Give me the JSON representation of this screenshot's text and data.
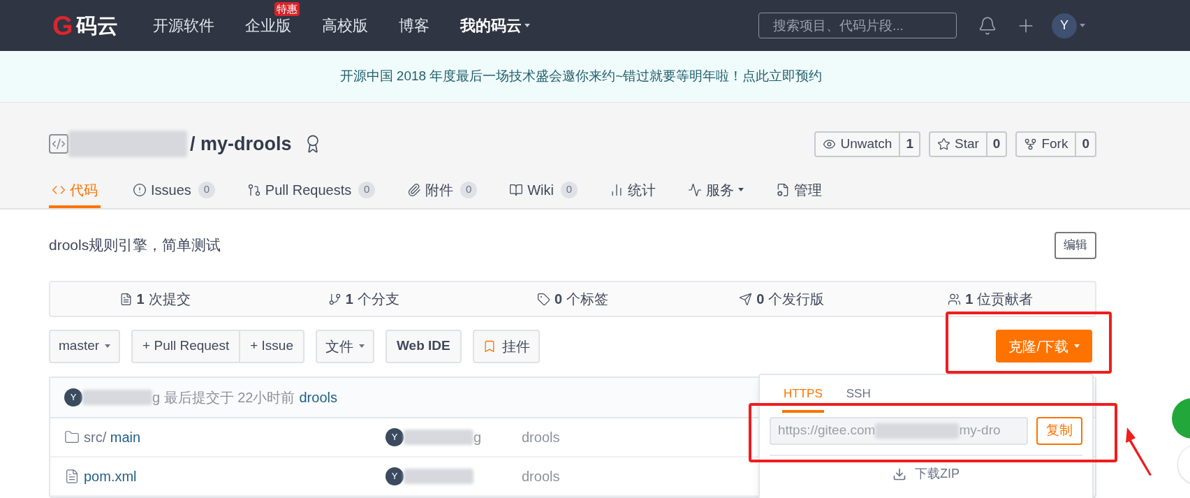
{
  "nav": {
    "logo_mark": "G",
    "logo_text": "码云",
    "items": [
      {
        "label": "开源软件",
        "selected": false,
        "dropdown": false
      },
      {
        "label": "企业版",
        "selected": false,
        "dropdown": false,
        "badge": "特惠"
      },
      {
        "label": "高校版",
        "selected": false,
        "dropdown": false
      },
      {
        "label": "博客",
        "selected": false,
        "dropdown": false
      },
      {
        "label": "我的码云",
        "selected": true,
        "dropdown": true
      }
    ],
    "search": {
      "placeholder": "搜索项目、代码片段..."
    },
    "avatar": "Y"
  },
  "banner": {
    "text": "开源中国 2018 年度最后一场技术盛会邀你来约~错过就要等明年啦！点此立即预约"
  },
  "repo": {
    "name": "/ my-drools",
    "actions": [
      {
        "label": "Unwatch",
        "count": "1"
      },
      {
        "label": "Star",
        "count": "0"
      },
      {
        "label": "Fork",
        "count": "0"
      }
    ]
  },
  "tabs": [
    {
      "label": "代码",
      "selected": true,
      "dropdown": false
    },
    {
      "label": "Issues",
      "count": "0",
      "selected": false,
      "dropdown": false
    },
    {
      "label": "Pull Requests",
      "count": "0",
      "selected": false,
      "dropdown": false
    },
    {
      "label": "附件",
      "count": "0",
      "selected": false,
      "dropdown": false
    },
    {
      "label": "Wiki",
      "count": "0",
      "selected": false,
      "dropdown": false
    },
    {
      "label": "统计",
      "selected": false,
      "dropdown": false
    },
    {
      "label": "服务",
      "selected": false,
      "dropdown": true
    },
    {
      "label": "管理",
      "selected": false,
      "dropdown": false
    }
  ],
  "description": "drools规则引擎，简单测试",
  "edit_button": "编辑",
  "stats": [
    {
      "count": "1",
      "label": "次提交"
    },
    {
      "count": "1",
      "label": "个分支"
    },
    {
      "count": "0",
      "label": "个标签"
    },
    {
      "count": "0",
      "label": "个发行版"
    },
    {
      "count": "1",
      "label": "位贡献者"
    }
  ],
  "toolbar": {
    "branch": "master",
    "pull_request": "+ Pull Request",
    "issue": "+ Issue",
    "file": "文件",
    "web_ide": "Web IDE",
    "widget": "挂件",
    "clone": "克隆/下载"
  },
  "files": {
    "commit": {
      "avatar": "Y",
      "author_tail": "g",
      "info": "最后提交于 22小时前",
      "message": "drools"
    },
    "rows": [
      {
        "kind": "folder",
        "prefix": "src/ ",
        "name": "main",
        "avatar": "Y",
        "author_tail": "g",
        "message": "drools"
      },
      {
        "kind": "file",
        "name": "pom.xml",
        "avatar": "Y",
        "message": "drools"
      }
    ]
  },
  "clone_panel": {
    "tabs": [
      {
        "label": "HTTPS",
        "selected": true
      },
      {
        "label": "SSH",
        "selected": false
      }
    ],
    "url_start": "https://gitee.com",
    "url_end": "my-dro",
    "copy": "复制",
    "download": "下载ZIP"
  }
}
